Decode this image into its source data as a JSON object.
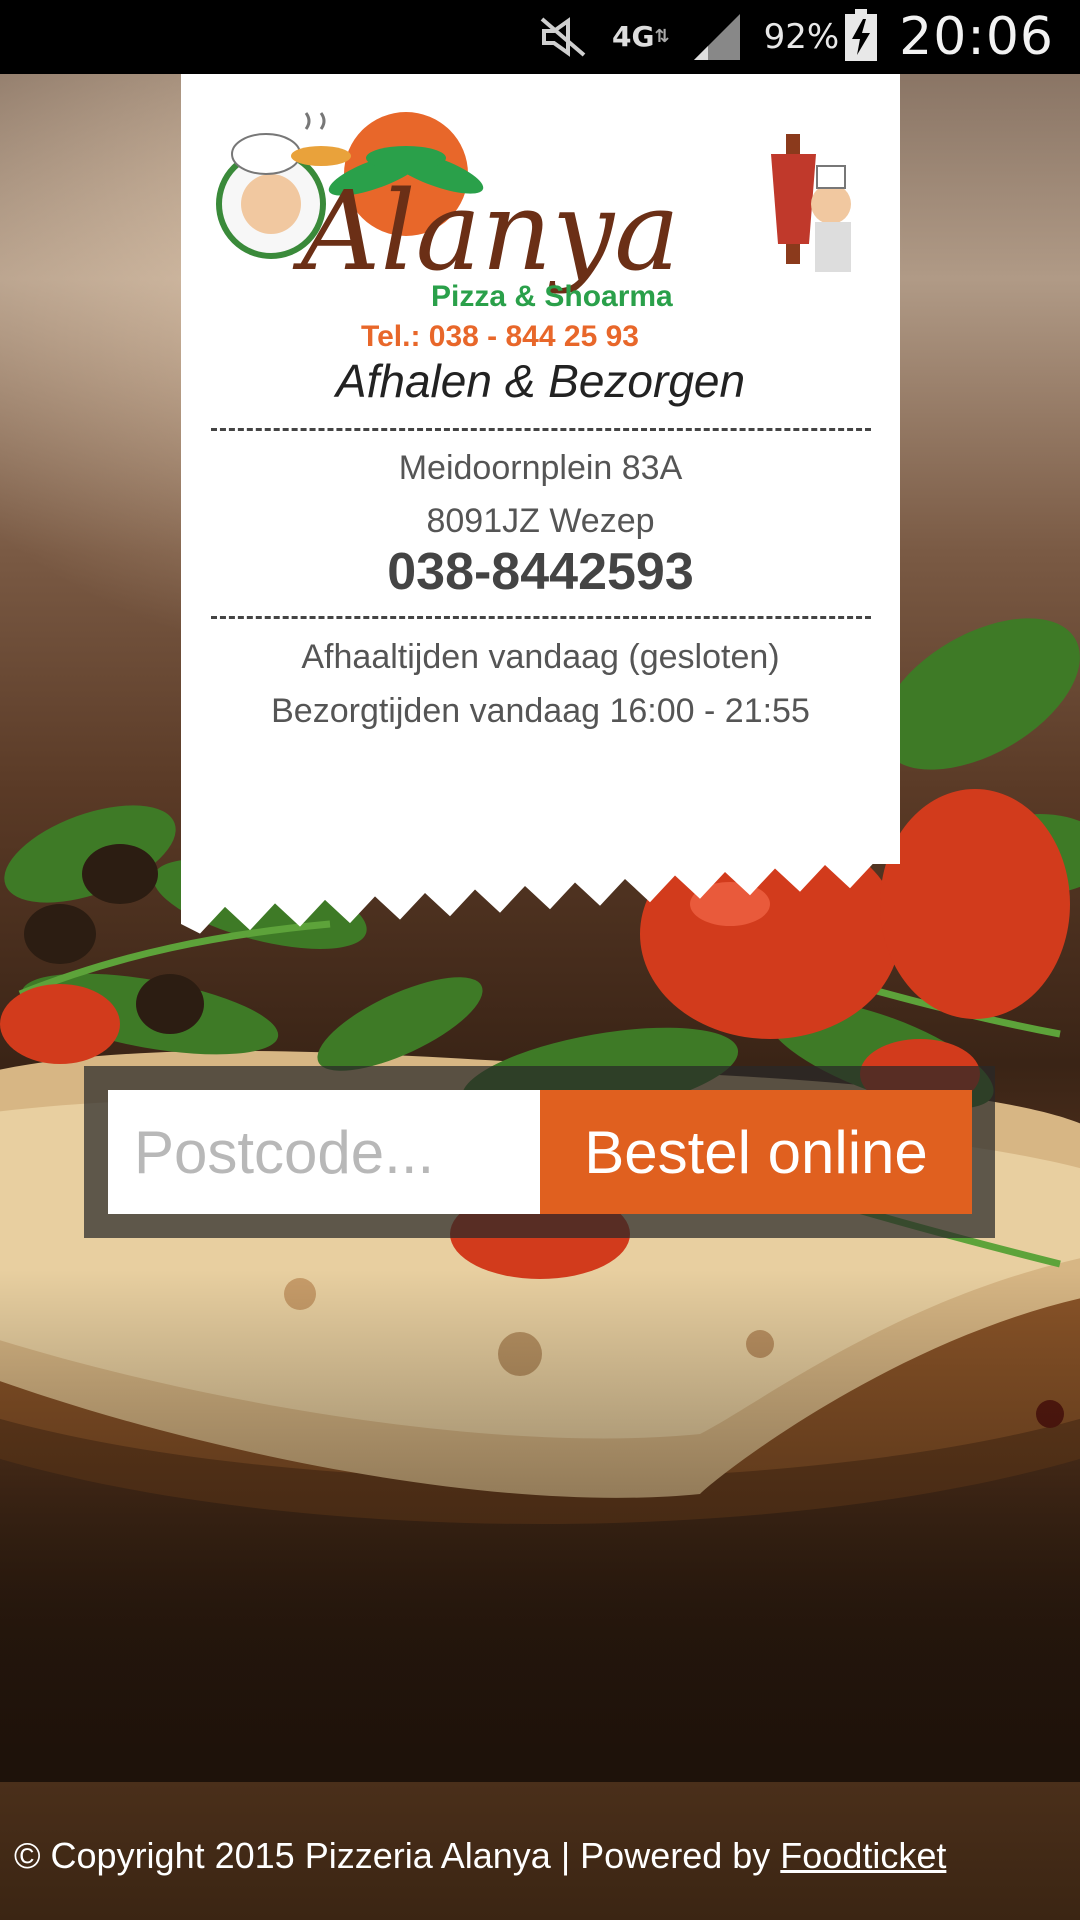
{
  "status_bar": {
    "network": "4G",
    "battery": "92%",
    "time": "20:06",
    "icons": [
      "mute-icon",
      "network-4g-icon",
      "signal-icon",
      "battery-charging-icon"
    ]
  },
  "logo": {
    "brand": "Alanya",
    "subtitle": "Pizza & Shoarma",
    "tel": "Tel.: 038 - 844 25 93"
  },
  "receipt": {
    "tagline": "Afhalen & Bezorgen",
    "street": "Meidoornplein 83A",
    "city": "8091JZ Wezep",
    "phone": "038-8442593",
    "pickup_hours": "Afhaaltijden vandaag (gesloten)",
    "delivery_hours": "Bezorgtijden vandaag 16:00 - 21:55"
  },
  "order": {
    "postcode_placeholder": "Postcode...",
    "postcode_value": "",
    "button_label": "Bestel online"
  },
  "footer": {
    "copyright": "© Copyright 2015 Pizzeria Alanya | Powered by ",
    "link_label": "Foodticket"
  },
  "colors": {
    "accent": "#e0601f",
    "status_bar": "#000000",
    "receipt_paper": "#ffffff",
    "footer": "#3f2815"
  }
}
